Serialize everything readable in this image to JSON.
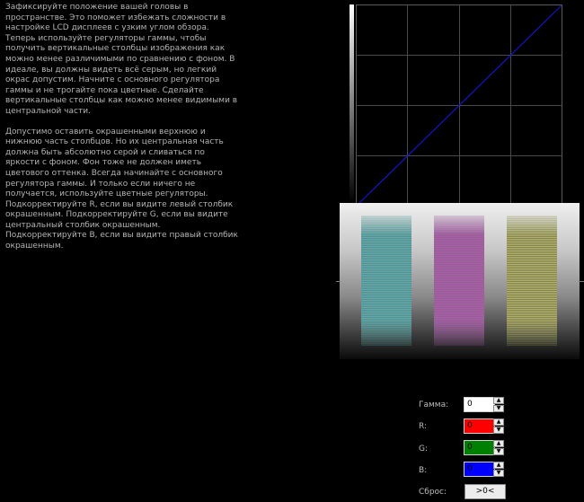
{
  "instructions": {
    "paragraph1": "Зафиксируйте положение вашей головы в пространстве. Это поможет избежать сложности в настройке LCD дисплеев с узким углом обзора. Теперь используйте регуляторы гаммы, чтобы получить вертикальные столбцы изображения как можно менее различимыми по сравнению с фоном. В идеале, вы должны видеть всё серым, но легкий окрас допустим. Начните с основного регулятора гаммы и не трогайте пока цветные. Сделайте вертикальные столбцы как можно менее видимыми в центральной части.",
    "paragraph2": "Допустимо оставить окрашенными верхнюю и нижнюю часть столбцов. Но их центральная часть должна быть абсолютно серой и сливаться по яркости с фоном. Фон тоже не должен иметь цветового оттенка. Всегда начинайте с основного регулятора гаммы. И только если ничего не получается, используйте цветные регуляторы. Подкорректируйте R, если вы видите левый столбик окрашенным. Подкорректируйте G, если вы видите центральный столбик окрашенным. Подкорректируйте B, если вы видите правый столбик окрашенным."
  },
  "controls": {
    "gamma": {
      "label": "Гамма:",
      "value": "0",
      "color": "#ffffff"
    },
    "r": {
      "label": "R:",
      "value": "0",
      "color": "#ff0000"
    },
    "g": {
      "label": "G:",
      "value": "0",
      "color": "#008000"
    },
    "b": {
      "label": "B:",
      "value": "0",
      "color": "#0000ff"
    },
    "reset": {
      "label": "Сброс:",
      "button": ">0<"
    }
  },
  "colors": {
    "curve": "#1515d0",
    "grid": "#5a5a5a",
    "background": "#000000"
  },
  "icons": {
    "up": "arrow-up-icon",
    "down": "arrow-down-icon"
  }
}
